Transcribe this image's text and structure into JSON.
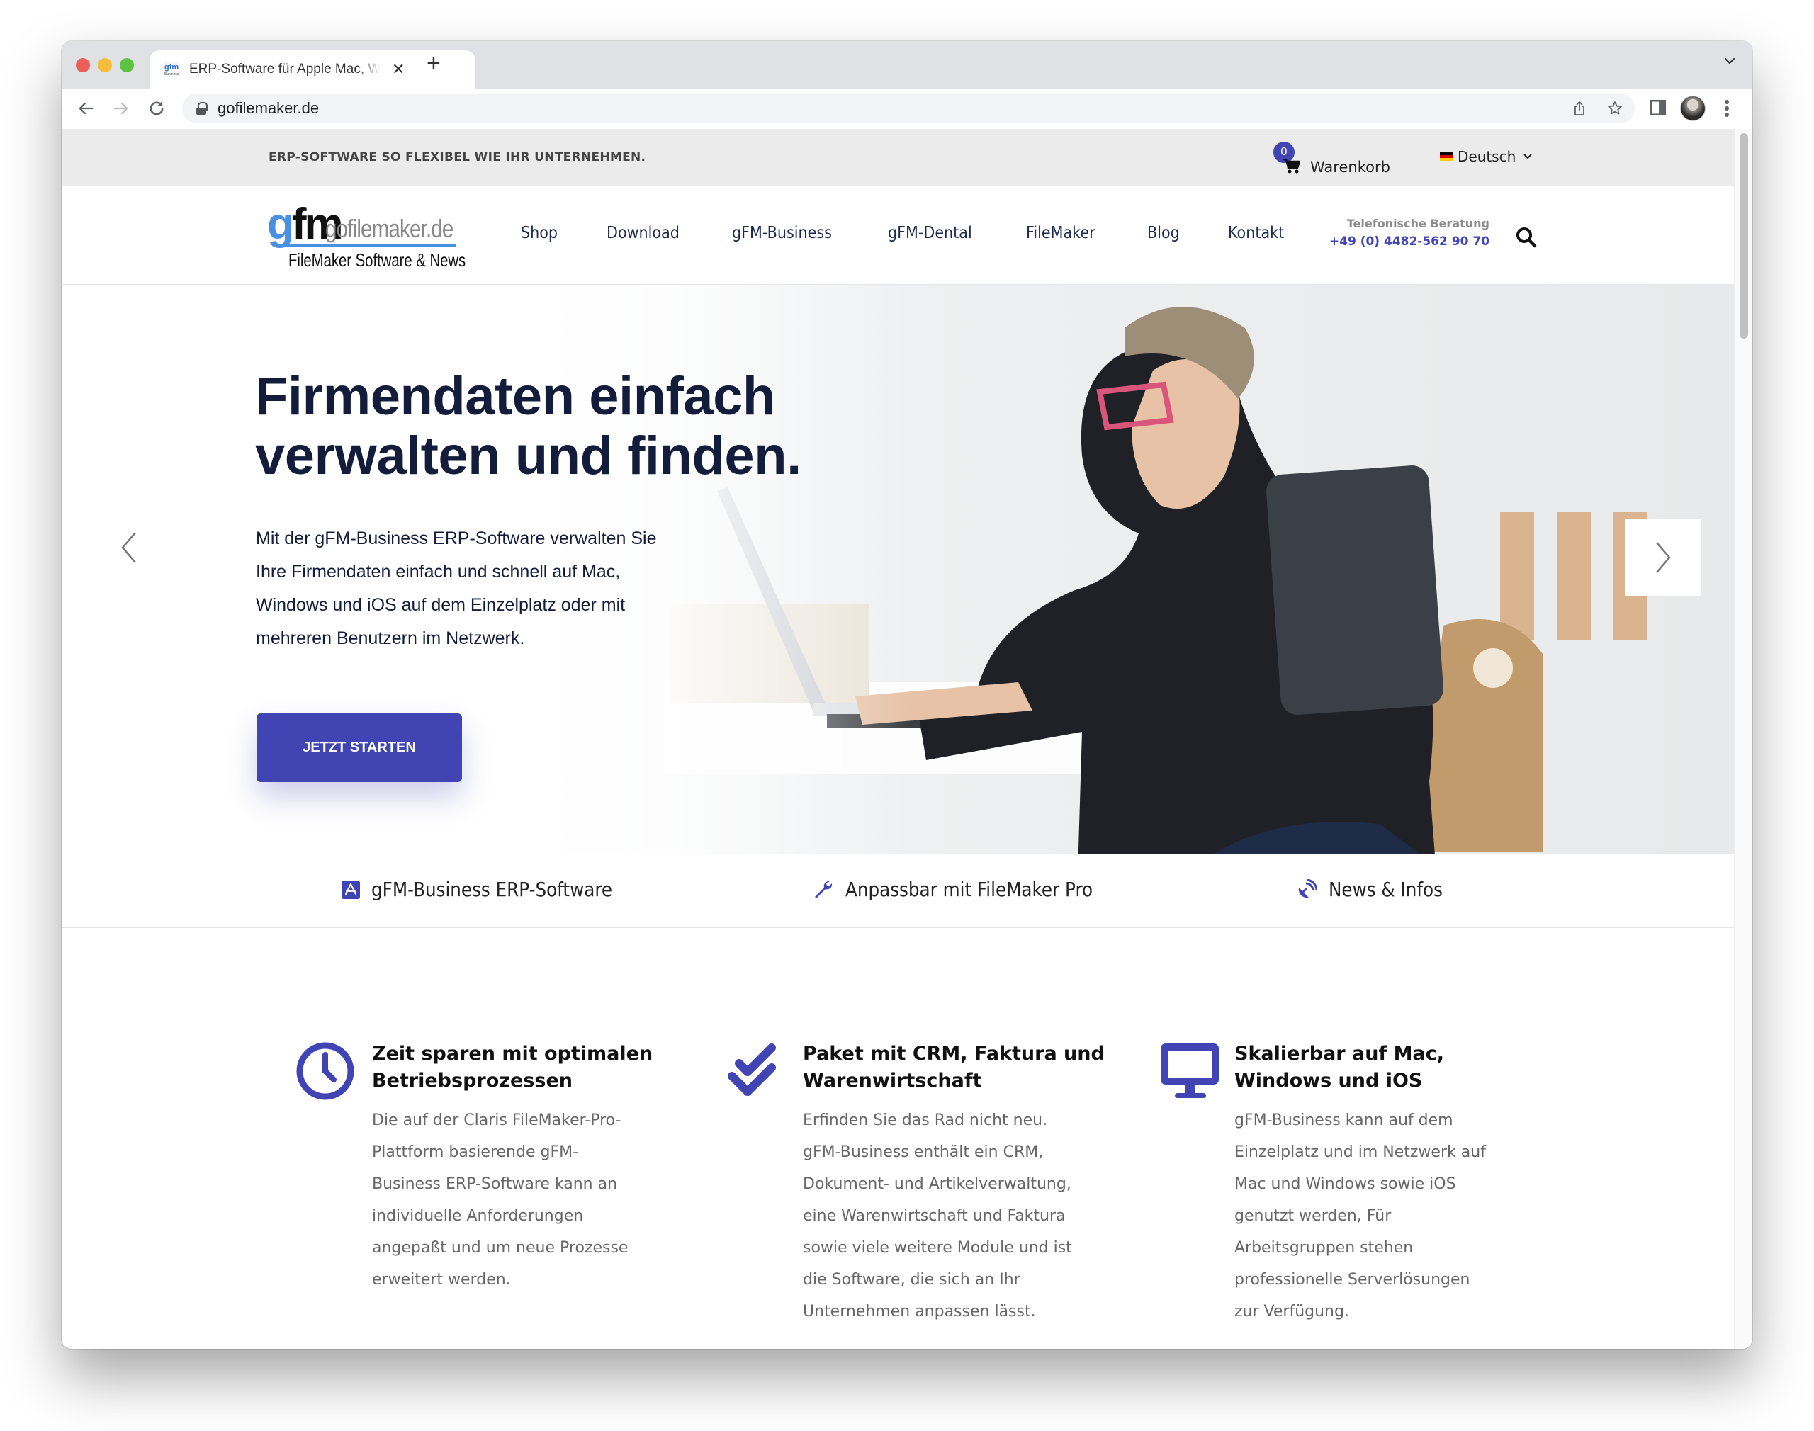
{
  "browser": {
    "tab_title": "ERP-Software für Apple Mac, Windows und iOS",
    "favicon_text": "gfm",
    "favicon_sub": "Business",
    "url": "gofilemaker.de"
  },
  "topbar": {
    "tagline": "ERP-SOFTWARE SO FLEXIBEL WIE IHR UNTERNEHMEN.",
    "cart_count": "0",
    "cart_label": "Warenkorb",
    "language": "Deutsch"
  },
  "header": {
    "logo": {
      "g": "g",
      "fm": "fm",
      "domain": "gofilemaker.de",
      "subtitle": "FileMaker Software & News"
    },
    "nav": [
      "Shop",
      "Download",
      "gFM-Business",
      "gFM-Dental",
      "FileMaker",
      "Blog",
      "Kontakt"
    ],
    "phone_label": "Telefonische Beratung",
    "phone_number": "+49 (0) 4482-562 90 70"
  },
  "hero": {
    "title_line1": "Firmendaten einfach",
    "title_line2": "verwalten und finden.",
    "text_lines": [
      "Mit der gFM-Business ERP-Software verwalten Sie",
      "Ihre Firmendaten einfach und schnell auf Mac,",
      "Windows und iOS auf dem Einzelplatz oder mit",
      "mehreren Benutzern im Netzwerk."
    ],
    "cta_label": "JETZT STARTEN"
  },
  "featurebar": [
    {
      "icon": "app-store-icon",
      "label": "gFM-Business ERP-Software"
    },
    {
      "icon": "wrench-icon",
      "label": "Anpassbar mit FileMaker Pro"
    },
    {
      "icon": "satellite-dish-icon",
      "label": "News & Infos"
    }
  ],
  "features": [
    {
      "icon": "clock-icon",
      "title_lines": [
        "Zeit sparen mit optimalen",
        "Betriebsprozessen"
      ],
      "text_lines": [
        "Die auf der Claris FileMaker-Pro-",
        "Plattform basierende gFM-",
        "Business ERP-Software kann an",
        "individuelle Anforderungen",
        "angepaßt und um neue Prozesse",
        "erweitert werden."
      ]
    },
    {
      "icon": "double-check-icon",
      "title_lines": [
        "Paket mit CRM, Faktura und",
        "Warenwirtschaft"
      ],
      "text_lines": [
        "Erfinden Sie das Rad nicht neu.",
        "gFM-Business enthält ein CRM,",
        "Dokument- und Artikelverwaltung,",
        "eine Warenwirtschaft und Faktura",
        "sowie viele weitere Module und ist",
        "die Software, die sich an Ihr",
        "Unternehmen anpassen lässt."
      ]
    },
    {
      "icon": "desktop-icon",
      "title_lines": [
        "Skalierbar auf Mac,",
        "Windows und iOS"
      ],
      "text_lines": [
        "gFM-Business kann auf dem",
        "Einzelplatz und im Netzwerk auf",
        "Mac und Windows sowie iOS",
        "genutzt werden, Für",
        "Arbeitsgruppen stehen",
        "professionelle Serverlösungen",
        "zur Verfügung."
      ]
    }
  ],
  "colors": {
    "brand": "#4145b4",
    "heading": "#131c3a",
    "nav_text": "#1d2b4f",
    "logo_blue": "#4a90e2"
  }
}
